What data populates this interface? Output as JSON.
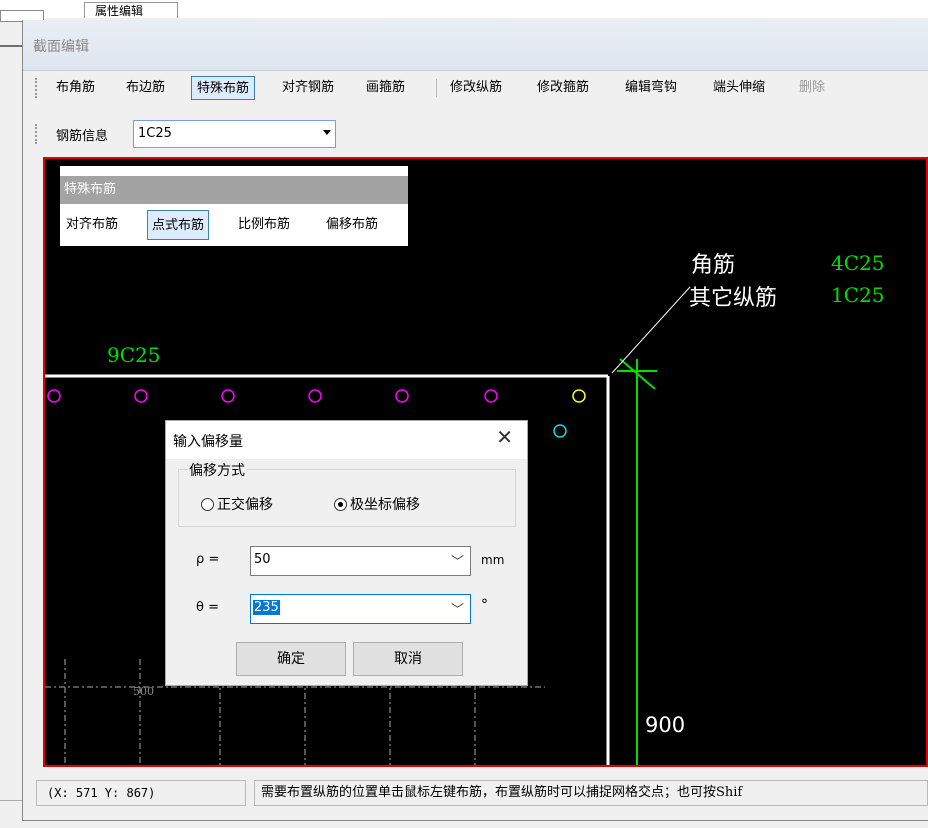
{
  "background": {
    "top_tab_label": "属性编辑"
  },
  "window": {
    "title": "截面编辑"
  },
  "toolbar": {
    "items": [
      "布角筋",
      "布边筋",
      "特殊布筋",
      "对齐钢筋",
      "画箍筋",
      "修改纵筋",
      "修改箍筋",
      "编辑弯钩",
      "端头伸缩",
      "删除"
    ],
    "active": "特殊布筋",
    "disabled": "删除",
    "rebar_info_label": "钢筋信息",
    "rebar_info_value": "1C25"
  },
  "special_panel": {
    "title": "特殊布筋",
    "buttons": [
      "对齐布筋",
      "点式布筋",
      "比例布筋",
      "偏移布筋"
    ],
    "active": "点式布筋"
  },
  "canvas": {
    "annotation_corner_label": "角筋",
    "annotation_corner_value": "4C25",
    "annotation_other_label": "其它纵筋",
    "annotation_other_value": "1C25",
    "edge_label": "9C25",
    "dimension_label": "900",
    "grid_label": "500",
    "colors": {
      "background": "#000000",
      "border": "#e00000",
      "green": "#00e000",
      "magenta": "#ff00ff",
      "yellow": "#ffff00",
      "cyan": "#00e0e0",
      "white": "#ffffff"
    }
  },
  "dialog": {
    "title": "输入偏移量",
    "close_icon": "close-icon",
    "group_title": "偏移方式",
    "radio_orthogonal": "正交偏移",
    "radio_polar": "极坐标偏移",
    "selected_mode": "极坐标偏移",
    "rho_label": "ρ =",
    "rho_value": "50",
    "rho_unit": "mm",
    "theta_label": "θ =",
    "theta_value": "235",
    "theta_unit": "°",
    "ok_label": "确定",
    "cancel_label": "取消"
  },
  "statusbar": {
    "coords": "(X: 571 Y: 867)",
    "message": "需要布置纵筋的位置单击鼠标左键布筋，布置纵筋时可以捕捉网格交点；也可按Shif"
  }
}
